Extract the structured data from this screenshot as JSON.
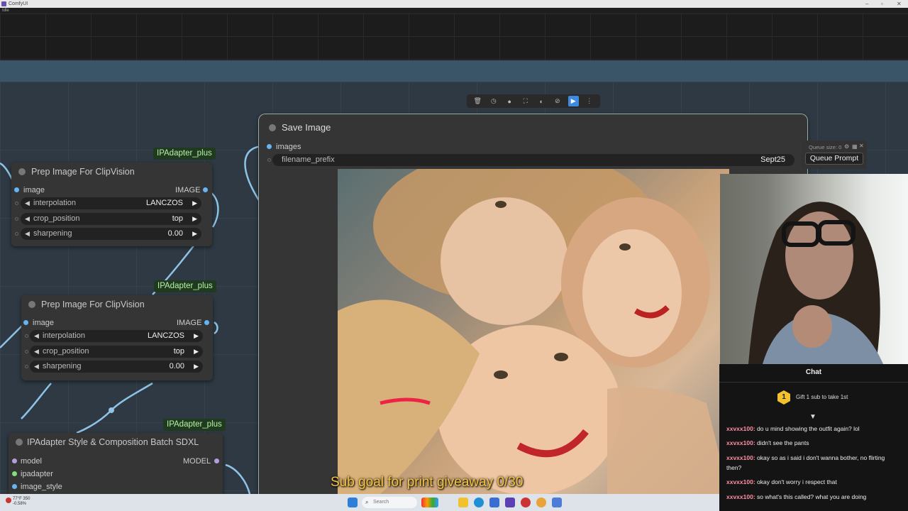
{
  "window": {
    "title": "ComfyUI",
    "menu_label": "Idle"
  },
  "toolbar": {
    "buttons": [
      {
        "name": "trash-icon",
        "glyph": "🗑"
      },
      {
        "name": "history-icon",
        "glyph": "◷"
      },
      {
        "name": "color-dot-icon",
        "glyph": "●"
      },
      {
        "name": "fit-view-icon",
        "glyph": "⛶"
      },
      {
        "name": "palette-icon",
        "glyph": "◐"
      },
      {
        "name": "bypass-icon",
        "glyph": "⊘"
      },
      {
        "name": "run-icon",
        "glyph": "▶"
      },
      {
        "name": "more-icon",
        "glyph": "⋮"
      }
    ]
  },
  "nodes": {
    "prep1": {
      "badge": "IPAdapter_plus",
      "title": "Prep Image For ClipVision",
      "input": "image",
      "output": "IMAGE",
      "widgets": [
        {
          "label": "interpolation",
          "value": "LANCZOS"
        },
        {
          "label": "crop_position",
          "value": "top"
        },
        {
          "label": "sharpening",
          "value": "0.00"
        }
      ]
    },
    "prep2": {
      "badge": "IPAdapter_plus",
      "title": "Prep Image For ClipVision",
      "input": "image",
      "output": "IMAGE",
      "widgets": [
        {
          "label": "interpolation",
          "value": "LANCZOS"
        },
        {
          "label": "crop_position",
          "value": "top"
        },
        {
          "label": "sharpening",
          "value": "0.00"
        }
      ]
    },
    "style": {
      "badge": "IPAdapter_plus",
      "title": "IPAdapter Style & Composition Batch SDXL",
      "inputs": [
        "model",
        "ipadapter",
        "image_style"
      ],
      "output": "MODEL"
    },
    "save": {
      "title": "Save Image",
      "input": "images",
      "widget": {
        "label": "filename_prefix",
        "value": "Sept25"
      }
    }
  },
  "queue": {
    "size_label": "Queue size: 0",
    "button": "Queue Prompt"
  },
  "chat": {
    "title": "Chat",
    "gift_badge": "1",
    "gift_text": "Gift 1 sub to take 1st",
    "messages": [
      {
        "user": "xxvxx100",
        "text": "do u mind showing the outfit again? lol"
      },
      {
        "user": "xxvxx100",
        "text": "didn't see the pants"
      },
      {
        "user": "xxvxx100",
        "text": "okay so as i said i don't wanna bother, no flirting then?"
      },
      {
        "user": "xxvxx100",
        "text": "okay don't worry i respect that"
      },
      {
        "user": "xxvxx100",
        "text": "so what's this called? what you are doing"
      }
    ]
  },
  "overlay": {
    "sub_goal": "Sub goal for print giveaway 0/30"
  },
  "taskbar": {
    "weather_temp": "77°F 350",
    "weather_sub": "-0.58%",
    "search_placeholder": "Search"
  },
  "colors": {
    "badge_bg": "#1f3a1f",
    "badge_text": "#b8f0a8",
    "port_image": "#64b5f6",
    "port_model": "#b39ddb",
    "port_ipadapter": "#7ee07e",
    "link_color": "#8fc4e8",
    "chat_user": "#ff8fa3",
    "sub_goal": "#f5c542"
  }
}
